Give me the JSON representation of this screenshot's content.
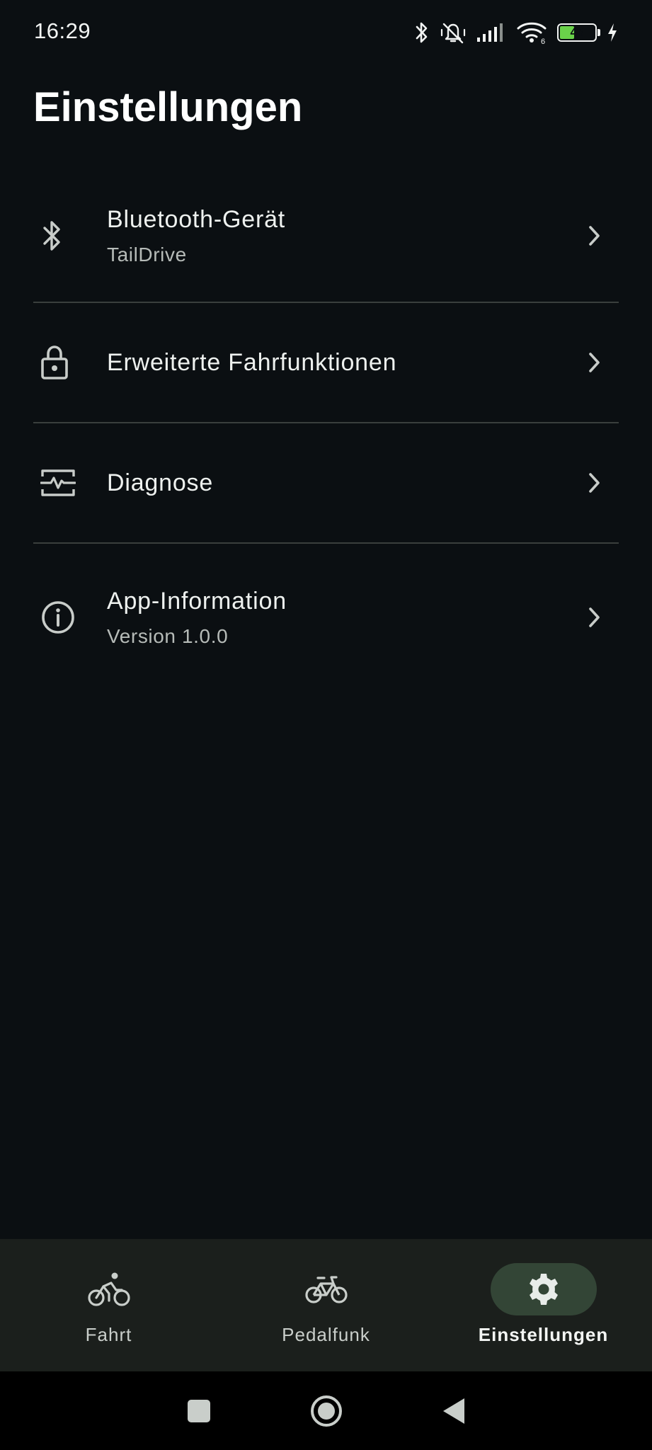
{
  "status_bar": {
    "time": "16:29",
    "battery_level": "43",
    "battery_fraction": 0.43,
    "icons": [
      "bluetooth-icon",
      "vibrate-mute-icon",
      "signal-icon",
      "wifi-icon",
      "battery-icon",
      "charging-icon"
    ],
    "wifi_badge": "6"
  },
  "header": {
    "title": "Einstellungen"
  },
  "settings": {
    "items": [
      {
        "icon": "bluetooth-icon",
        "title": "Bluetooth-Gerät",
        "subtitle": "TailDrive"
      },
      {
        "icon": "lock-icon",
        "title": "Erweiterte Fahrfunktionen"
      },
      {
        "icon": "diagnose-icon",
        "title": "Diagnose"
      },
      {
        "icon": "info-icon",
        "title": "App-Information",
        "subtitle": "Version 1.0.0"
      }
    ]
  },
  "bottom_nav": {
    "items": [
      {
        "icon": "cyclist-icon",
        "label": "Fahrt"
      },
      {
        "icon": "bicycle-icon",
        "label": "Pedalfunk"
      },
      {
        "icon": "gear-icon",
        "label": "Einstellungen",
        "active": true
      }
    ]
  },
  "colors": {
    "background": "#0b0f12",
    "nav_background": "#1b1f1c",
    "active_pill": "#334536",
    "battery_green": "#6ad24a"
  }
}
